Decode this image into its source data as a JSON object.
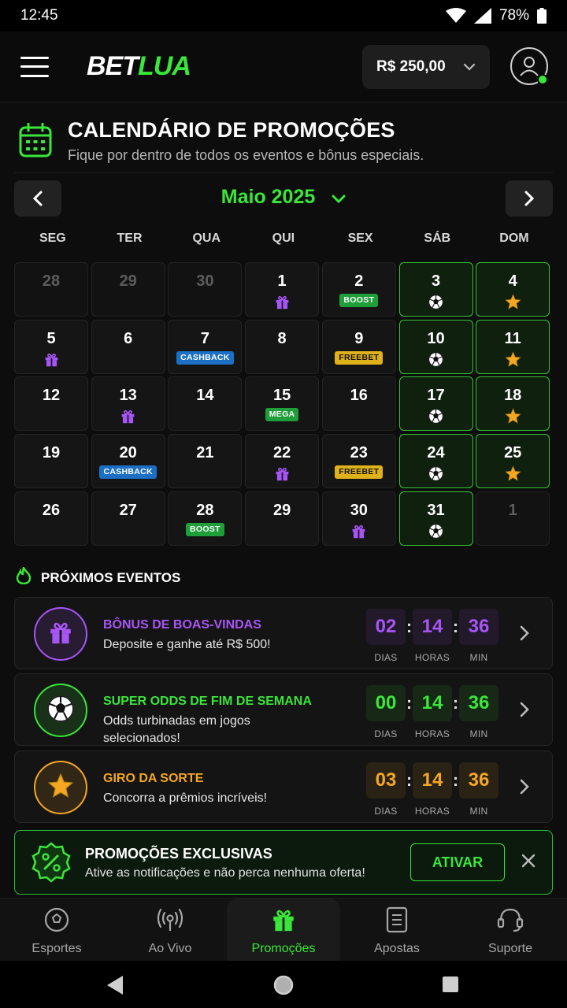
{
  "status": {
    "time": "12:45",
    "battery": "78%"
  },
  "header": {
    "logo_a": "BET",
    "logo_b": "LUA",
    "balance": "R$ 250,00"
  },
  "page": {
    "title": "CALENDÁRIO DE PROMOÇÕES",
    "subtitle": "Fique por dentro de todos os eventos e bônus especiais."
  },
  "calendar": {
    "month": "Maio 2025",
    "weekdays": [
      "SEG",
      "TER",
      "QUA",
      "QUI",
      "SEX",
      "SÁB",
      "DOM"
    ],
    "rows": [
      [
        {
          "d": "28",
          "muted": true
        },
        {
          "d": "29",
          "muted": true
        },
        {
          "d": "30",
          "muted": true
        },
        {
          "d": "1",
          "mark": "gift"
        },
        {
          "d": "2",
          "badge": "BOOST",
          "type": "boost"
        },
        {
          "d": "3",
          "mark": "ball",
          "weekend": true
        },
        {
          "d": "4",
          "mark": "star",
          "weekend": true
        }
      ],
      [
        {
          "d": "5",
          "mark": "gift"
        },
        {
          "d": "6"
        },
        {
          "d": "7",
          "badge": "CASHBACK",
          "type": "cashback"
        },
        {
          "d": "8"
        },
        {
          "d": "9",
          "badge": "FREEBET",
          "type": "freebet"
        },
        {
          "d": "10",
          "mark": "ball",
          "weekend": true
        },
        {
          "d": "11",
          "mark": "star",
          "weekend": true
        }
      ],
      [
        {
          "d": "12"
        },
        {
          "d": "13",
          "mark": "gift"
        },
        {
          "d": "14"
        },
        {
          "d": "15",
          "badge": "MEGA",
          "type": "mega"
        },
        {
          "d": "16"
        },
        {
          "d": "17",
          "mark": "ball",
          "weekend": true
        },
        {
          "d": "18",
          "mark": "star",
          "weekend": true
        }
      ],
      [
        {
          "d": "19"
        },
        {
          "d": "20",
          "badge": "CASHBACK",
          "type": "cashback"
        },
        {
          "d": "21"
        },
        {
          "d": "22",
          "mark": "gift"
        },
        {
          "d": "23",
          "badge": "FREEBET",
          "type": "freebet"
        },
        {
          "d": "24",
          "mark": "ball",
          "weekend": true
        },
        {
          "d": "25",
          "mark": "star",
          "weekend": true
        }
      ],
      [
        {
          "d": "26"
        },
        {
          "d": "27"
        },
        {
          "d": "28",
          "badge": "BOOST",
          "type": "boost"
        },
        {
          "d": "29"
        },
        {
          "d": "30",
          "mark": "gift"
        },
        {
          "d": "31",
          "mark": "ball",
          "weekend": true
        },
        {
          "d": "1",
          "muted": true
        }
      ]
    ]
  },
  "events": {
    "heading": "PRÓXIMOS EVENTOS",
    "units": {
      "days": "DIAS",
      "hours": "HORAS",
      "min": "MIN"
    },
    "items": [
      {
        "title": "BÔNUS DE BOAS-VINDAS",
        "desc": "Deposite e ganhe até R$ 500!",
        "days": "02",
        "hours": "14",
        "min": "36",
        "color": "#a855f7",
        "icon": "gift-icon"
      },
      {
        "title": "SUPER ODDS DE FIM DE SEMANA",
        "desc": "Odds turbinadas em jogos selecionados!",
        "days": "00",
        "hours": "14",
        "min": "36",
        "color": "#39e639",
        "icon": "soccer-ball-icon"
      },
      {
        "title": "GIRO DA SORTE",
        "desc": "Concorra a prêmios incríveis!",
        "days": "03",
        "hours": "14",
        "min": "36",
        "color": "#f5a623",
        "icon": "star-icon"
      }
    ]
  },
  "exclusive": {
    "title": "PROMOÇÕES EXCLUSIVAS",
    "desc": "Ative as notificações e não perca nenhuma oferta!",
    "button": "ATIVAR"
  },
  "nav": [
    {
      "label": "Esportes",
      "icon": "soccer-icon"
    },
    {
      "label": "Ao Vivo",
      "icon": "live-icon"
    },
    {
      "label": "Promoções",
      "icon": "gift-icon",
      "active": true
    },
    {
      "label": "Apostas",
      "icon": "ticket-icon"
    },
    {
      "label": "Suporte",
      "icon": "headset-icon"
    }
  ],
  "colors": {
    "accent": "#39e639",
    "purple": "#a855f7",
    "gold": "#f5a623"
  }
}
